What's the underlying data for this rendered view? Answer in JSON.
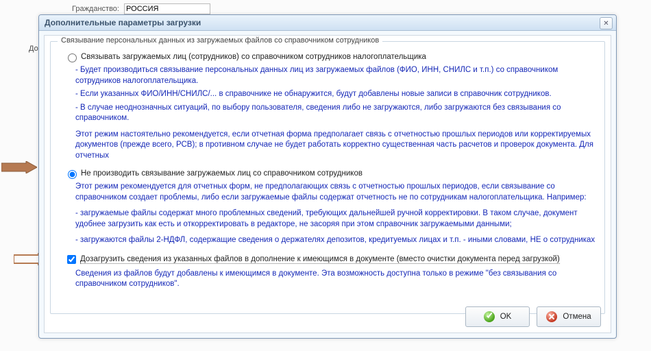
{
  "background": {
    "field_label": "Гражданство:",
    "field_value": "РОССИЯ",
    "d": "До"
  },
  "dialog": {
    "title": "Дополнительные параметры загрузки",
    "group_legend": "Связывание персональных данных из загружаемых файлов со справочником сотрудников",
    "radio1_label": "Связывать загружаемых лиц (сотрудников) со справочником сотрудников налогоплательщика",
    "radio1_bullets_1": "- Будет производиться связывание персональных данных лиц из загружаемых файлов (ФИО, ИНН, СНИЛС и т.п.) со справочником сотрудников налогоплательщика.",
    "radio1_bullets_2": "- Если указанных ФИО/ИНН/СНИЛС/... в справочнике не обнаружится, будут добавлены новые записи в справочник сотрудников.",
    "radio1_bullets_3": "- В случае неоднозначных ситуаций, по выбору пользователя, сведения либо не загружаются, либо загружаются без связывания со справочником.",
    "radio1_note": "Этот режим настоятельно рекомендуется, если отчетная форма предполагает связь с отчетностью прошлых периодов или корректируемых документов (прежде всего, РСВ); в противном случае не будет работать корректно существенная часть расчетов и проверок документа. Для отчетных",
    "radio2_label": "Не производить связывание загружаемых лиц со справочником сотрудников",
    "radio2_note1": "Этот режим рекомендуется для отчетных форм, не предполагающих связь с отчетностью прошлых периодов, если связывание со справочником создает проблемы, либо если загружаемые файлы содержат отчетность не по сотрудникам налогоплательщика. Например:",
    "radio2_note2": "- загружаемые файлы содержат много проблемных сведений, требующих дальнейшей ручной корректировки. В таком случае, документ удобнее загрузить как есть и откорректировать в редакторе, не засоряя при этом справочник загружаемыми данными;",
    "radio2_note3": "- загружаются файлы 2-НДФЛ, содержащие сведения о держателях депозитов, кредитуемых лицах и т.п. - иными словами, НЕ о сотрудниках",
    "checkbox_label": "Дозагрузить сведения из указанных файлов в дополнение к имеющимся в документе (вместо очистки документа перед загрузкой)",
    "checkbox_note": "Сведения из файлов будут добавлены к имеющимся в документе. Эта возможность доступна только в режиме \"без связывания со справочником сотрудников\".",
    "ok": "OK",
    "cancel": "Отмена"
  }
}
